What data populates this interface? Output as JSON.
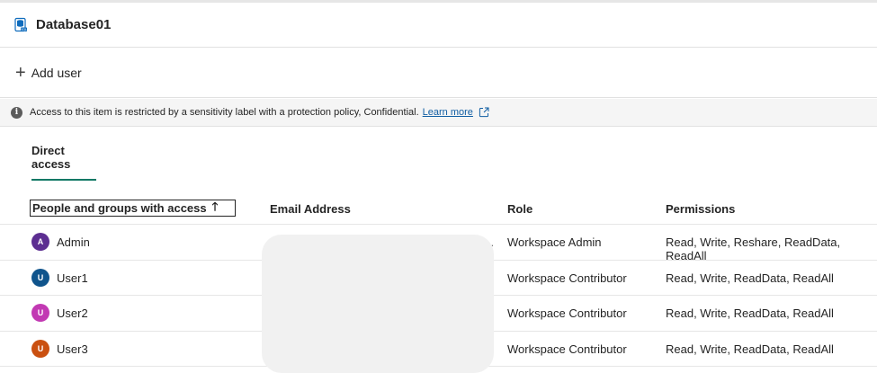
{
  "header": {
    "title": "Database01",
    "icon": "sql-database-icon"
  },
  "toolbar": {
    "add_user_label": "Add user"
  },
  "banner": {
    "message": "Access to this item is restricted by a sensitivity label with a protection policy, Confidential.",
    "link_label": "Learn more"
  },
  "tabs": [
    {
      "label": "Direct access",
      "active": true
    }
  ],
  "table": {
    "columns": {
      "people": "People and groups with access",
      "email": "Email Address",
      "role": "Role",
      "permissions": "Permissions"
    },
    "rows": [
      {
        "initial": "A",
        "name": "Admin",
        "role": "Workspace Admin",
        "permissions": "Read, Write, Reshare, ReadData, ReadAll",
        "color": "#5c2e91"
      },
      {
        "initial": "U",
        "name": "User1",
        "role": "Workspace Contributor",
        "permissions": "Read, Write, ReadData, ReadAll",
        "color": "#0f548c"
      },
      {
        "initial": "U",
        "name": "User2",
        "role": "Workspace Contributor",
        "permissions": "Read, Write, ReadData, ReadAll",
        "color": "#c239b3"
      },
      {
        "initial": "U",
        "name": "User3",
        "role": "Workspace Contributor",
        "permissions": "Read, Write, ReadData, ReadAll",
        "color": "#ca5010"
      }
    ],
    "truncation_marker": ".."
  },
  "colors": {
    "accent": "#117865",
    "link": "#115ea3",
    "banner_bg": "#f5f5f5"
  }
}
